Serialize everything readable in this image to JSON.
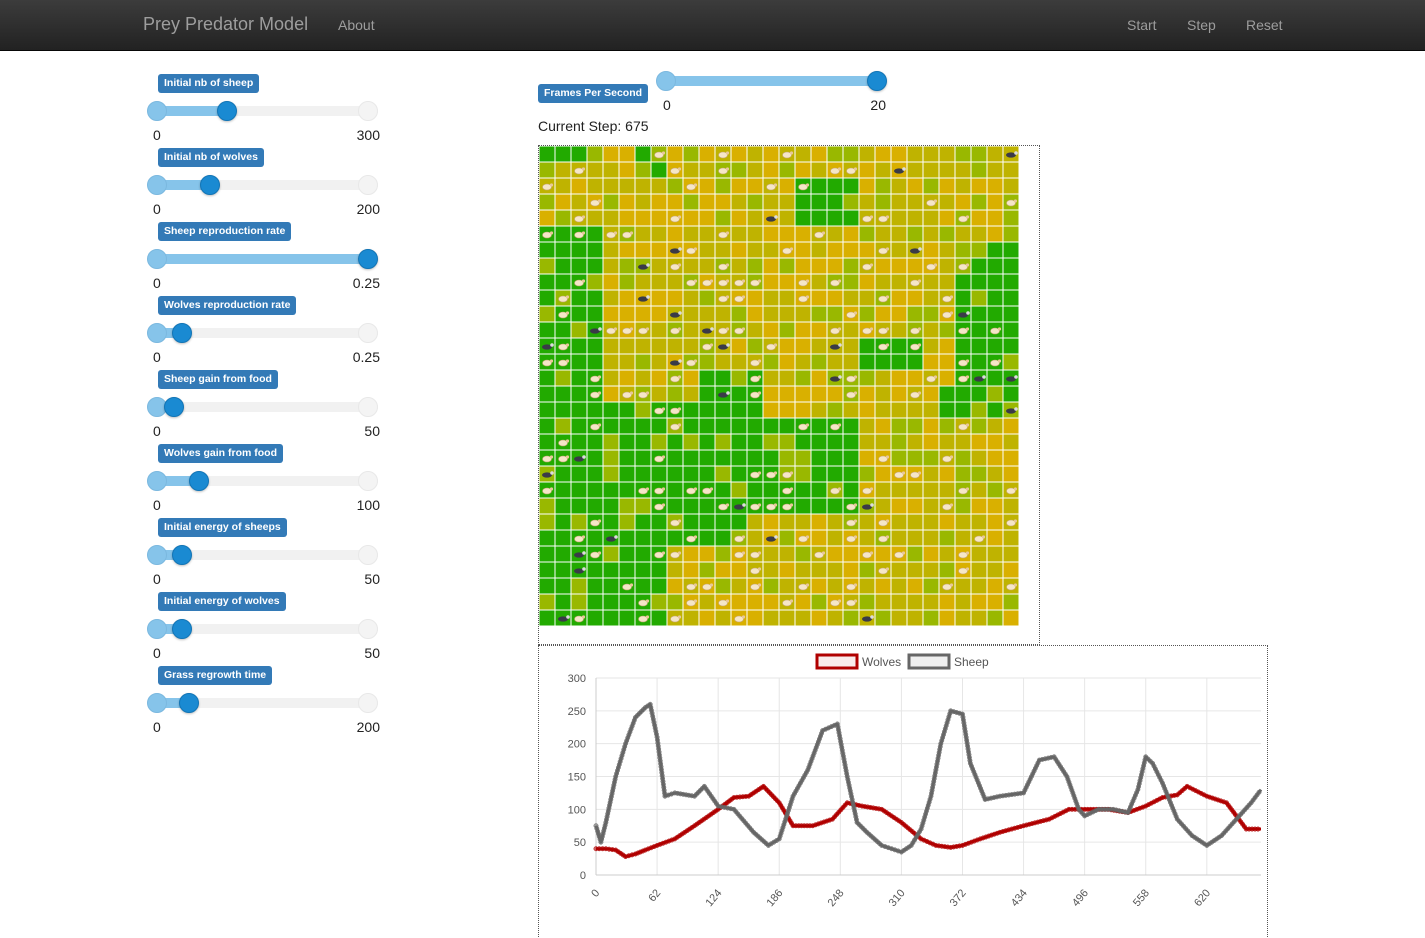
{
  "navbar": {
    "brand": "Prey Predator Model",
    "links": [
      "About"
    ],
    "actions": [
      "Start",
      "Step",
      "Reset"
    ]
  },
  "params": [
    {
      "label": "Initial nb of sheep",
      "min": "0",
      "max": "300",
      "value": 100,
      "maxval": 300
    },
    {
      "label": "Initial nb of wolves",
      "min": "0",
      "max": "200",
      "value": 50,
      "maxval": 200
    },
    {
      "label": "Sheep reproduction rate",
      "min": "0",
      "max": "0.25",
      "value": 0.25,
      "maxval": 0.25
    },
    {
      "label": "Wolves reproduction rate",
      "min": "0",
      "max": "0.25",
      "value": 0.03,
      "maxval": 0.25
    },
    {
      "label": "Sheep gain from food",
      "min": "0",
      "max": "50",
      "value": 4,
      "maxval": 50
    },
    {
      "label": "Wolves gain from food",
      "min": "0",
      "max": "100",
      "value": 20,
      "maxval": 100
    },
    {
      "label": "Initial energy of sheeps",
      "min": "0",
      "max": "50",
      "value": 6,
      "maxval": 50
    },
    {
      "label": "Initial energy of wolves",
      "min": "0",
      "max": "50",
      "value": 6,
      "maxval": 50
    },
    {
      "label": "Grass regrowth time",
      "min": "0",
      "max": "200",
      "value": 30,
      "maxval": 200
    }
  ],
  "fps": {
    "label": "Frames Per Second",
    "min": "0",
    "max": "20",
    "value": 20,
    "maxval": 20
  },
  "current_step": {
    "label": "Current Step:",
    "value": "675"
  },
  "grid": {
    "cols": 30,
    "rows": 30,
    "colors": {
      "grass_full": "#22aa00",
      "grass_mid": "#99b800",
      "grass_eaten": "#d9b000",
      "grass_low": "#bfb300",
      "line": "#ffffff"
    },
    "legend": {
      "sheep": "sheep-icon",
      "wolf": "wolf-icon"
    }
  },
  "chart_data": {
    "type": "line",
    "legend": [
      "Wolves",
      "Sheep"
    ],
    "colors": {
      "Wolves": "#b00000",
      "Sheep": "#666666"
    },
    "ylim": [
      0,
      300
    ],
    "yticks": [
      0,
      50,
      100,
      150,
      200,
      250,
      300
    ],
    "xticks": [
      0,
      62,
      124,
      186,
      248,
      310,
      372,
      434,
      496,
      558,
      620
    ],
    "xlim": [
      0,
      675
    ],
    "series": [
      {
        "name": "Wolves",
        "x": [
          0,
          10,
          20,
          30,
          40,
          50,
          62,
          80,
          100,
          124,
          140,
          155,
          170,
          186,
          200,
          220,
          240,
          255,
          270,
          290,
          310,
          330,
          345,
          360,
          372,
          390,
          410,
          434,
          460,
          480,
          496,
          520,
          540,
          558,
          575,
          590,
          600,
          620,
          640,
          660,
          675
        ],
        "y": [
          40,
          40,
          38,
          28,
          32,
          38,
          45,
          55,
          75,
          100,
          118,
          120,
          135,
          110,
          75,
          75,
          85,
          110,
          105,
          100,
          80,
          55,
          45,
          42,
          45,
          55,
          65,
          75,
          85,
          100,
          100,
          100,
          95,
          105,
          118,
          122,
          135,
          120,
          110,
          70,
          70
        ]
      },
      {
        "name": "Sheep",
        "x": [
          0,
          5,
          10,
          20,
          30,
          40,
          50,
          55,
          62,
          70,
          80,
          100,
          110,
          124,
          140,
          160,
          175,
          186,
          200,
          215,
          230,
          245,
          255,
          265,
          275,
          290,
          300,
          310,
          320,
          330,
          340,
          350,
          360,
          372,
          380,
          395,
          410,
          434,
          450,
          465,
          478,
          490,
          496,
          510,
          525,
          540,
          550,
          558,
          565,
          575,
          590,
          605,
          620,
          635,
          650,
          665,
          675
        ],
        "y": [
          75,
          50,
          80,
          150,
          200,
          240,
          255,
          260,
          210,
          120,
          125,
          120,
          135,
          105,
          100,
          65,
          45,
          55,
          120,
          160,
          220,
          230,
          150,
          80,
          65,
          45,
          40,
          35,
          45,
          70,
          120,
          200,
          250,
          245,
          170,
          115,
          120,
          125,
          175,
          180,
          150,
          100,
          90,
          100,
          100,
          95,
          130,
          180,
          170,
          140,
          85,
          60,
          45,
          60,
          85,
          110,
          130
        ]
      }
    ]
  }
}
